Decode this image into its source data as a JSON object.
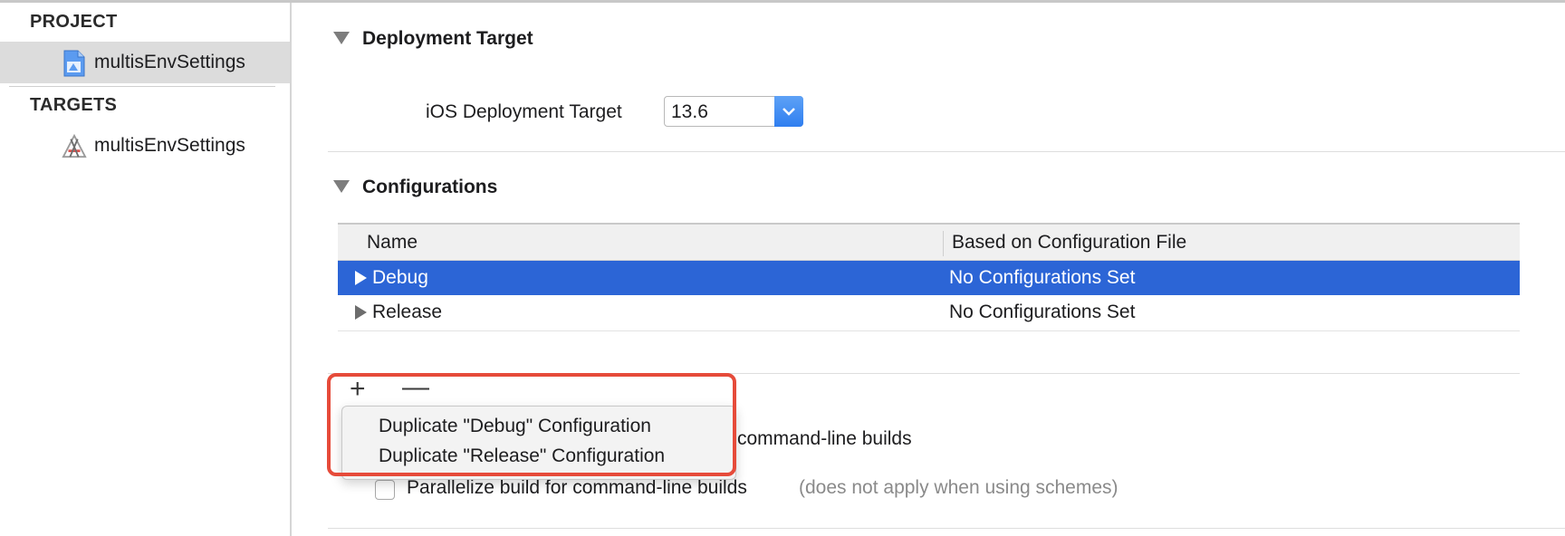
{
  "sidebar": {
    "project_header": "PROJECT",
    "project_item": {
      "label": "multisEnvSettings",
      "icon": "project-file-icon"
    },
    "targets_header": "TARGETS",
    "target_item": {
      "label": "multisEnvSettings",
      "icon": "app-target-icon"
    }
  },
  "deployment": {
    "title": "Deployment Target",
    "ios_label": "iOS Deployment Target",
    "ios_value": "13.6"
  },
  "configurations": {
    "title": "Configurations",
    "columns": [
      "Name",
      "Based on Configuration File"
    ],
    "rows": [
      {
        "name": "Debug",
        "based_on": "No Configurations Set",
        "selected": true
      },
      {
        "name": "Release",
        "based_on": "No Configurations Set",
        "selected": false
      }
    ],
    "add_label": "+",
    "remove_label": "—"
  },
  "menu": {
    "items": [
      "Duplicate \"Debug\" Configuration",
      "Duplicate \"Release\" Configuration"
    ]
  },
  "options": {
    "partial_text": "command-line builds",
    "parallelize_label": "Parallelize build for command-line builds",
    "parallelize_note": "(does not apply when using schemes)"
  },
  "colors": {
    "selection": "#2c65d6",
    "highlight": "#e64b3a",
    "accent": "#2f7ef0"
  }
}
